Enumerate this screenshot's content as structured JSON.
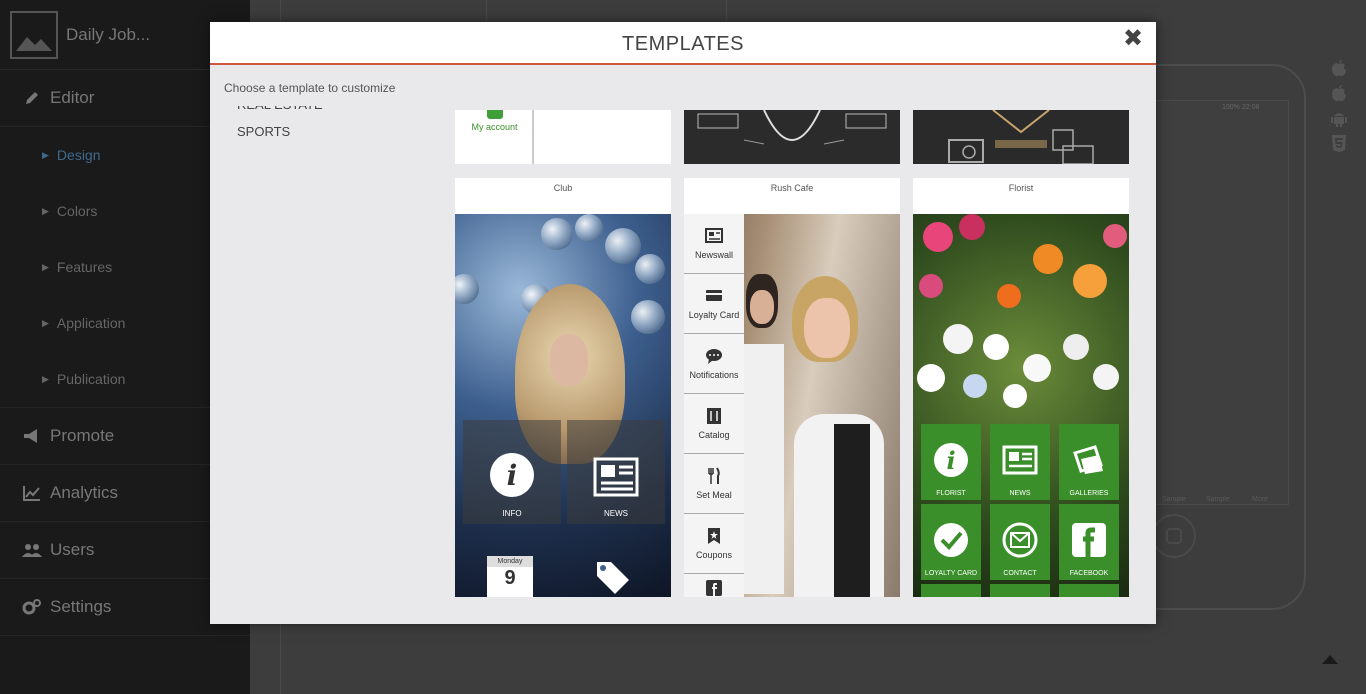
{
  "app": {
    "title": "Daily Job...",
    "nav": [
      {
        "label": "Editor",
        "icon": "pencil-icon"
      },
      {
        "label": "Promote",
        "icon": "megaphone-icon"
      },
      {
        "label": "Analytics",
        "icon": "chart-icon"
      },
      {
        "label": "Users",
        "icon": "users-icon"
      },
      {
        "label": "Settings",
        "icon": "gears-icon"
      }
    ],
    "editor_sub": [
      "Design",
      "Colors",
      "Features",
      "Application",
      "Publication"
    ],
    "phone": {
      "status": "100%  22:08",
      "tabs": [
        "Sample",
        "Sample",
        "More"
      ]
    }
  },
  "modal": {
    "title": "TEMPLATES",
    "subtitle": "Choose a template to customize",
    "categories": [
      "REAL ESTATE",
      "SPORTS"
    ],
    "top_row": {
      "first_button": "My account"
    },
    "templates": [
      {
        "name": "Club",
        "tiles": [
          "INFO",
          "NEWS"
        ],
        "calendar_month": "Monday",
        "calendar_day": "9"
      },
      {
        "name": "Rush Cafe",
        "menu": [
          "Newswall",
          "Loyalty Card",
          "Notifications",
          "Catalog",
          "Set Meal",
          "Coupons"
        ]
      },
      {
        "name": "Florist",
        "tiles": [
          "FLORIST",
          "NEWS",
          "GALLERIES",
          "LOYALTY CARD",
          "CONTACT",
          "FACEBOOK"
        ]
      }
    ]
  }
}
